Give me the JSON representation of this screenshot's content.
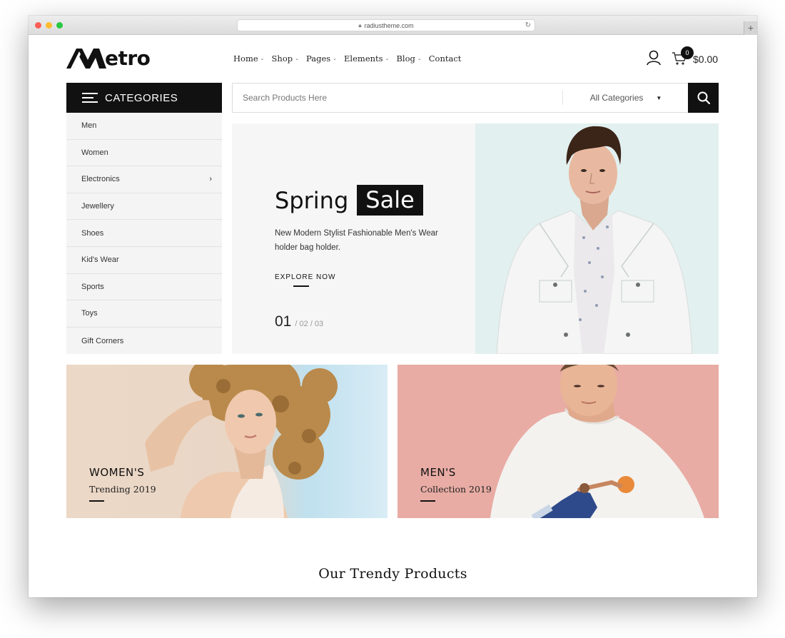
{
  "browser": {
    "url": "radiustheme.com"
  },
  "header": {
    "logo_rest": "etro",
    "logo_full": "Metro",
    "nav": [
      {
        "label": "Home",
        "has_dropdown": true
      },
      {
        "label": "Shop",
        "has_dropdown": true
      },
      {
        "label": "Pages",
        "has_dropdown": true
      },
      {
        "label": "Elements",
        "has_dropdown": true
      },
      {
        "label": "Blog",
        "has_dropdown": true
      },
      {
        "label": "Contact",
        "has_dropdown": false
      }
    ],
    "cart_count": "0",
    "cart_total": "$0.00"
  },
  "categories": {
    "title": "CATEGORIES",
    "items": [
      {
        "label": "Men"
      },
      {
        "label": "Women"
      },
      {
        "label": "Electronics",
        "has_submenu": true
      },
      {
        "label": "Jewellery"
      },
      {
        "label": "Shoes"
      },
      {
        "label": "Kid's Wear"
      },
      {
        "label": "Sports"
      },
      {
        "label": "Toys"
      },
      {
        "label": "Gift Corners"
      }
    ]
  },
  "search": {
    "placeholder": "Search Products Here",
    "category": "All Categories"
  },
  "hero": {
    "title_plain": "Spring",
    "title_tag": "Sale",
    "description": "New Modern Stylist Fashionable Men's Wear holder bag holder.",
    "cta": "EXPLORE NOW",
    "current_slide": "01",
    "other_slides": "/ 02  / 03"
  },
  "promos": [
    {
      "title": "WOMEN'S",
      "subtitle": "Trending 2019"
    },
    {
      "title": "MEN'S",
      "subtitle": "Collection 2019"
    }
  ],
  "section": {
    "title": "Our Trendy Products"
  },
  "colors": {
    "primary": "#111111",
    "sidebar_bg": "#f4f4f4",
    "hero_bg": "#f6f6f6",
    "hero_image_bg": "#e2f0ef",
    "men_banner_bg": "#e8aca4"
  }
}
